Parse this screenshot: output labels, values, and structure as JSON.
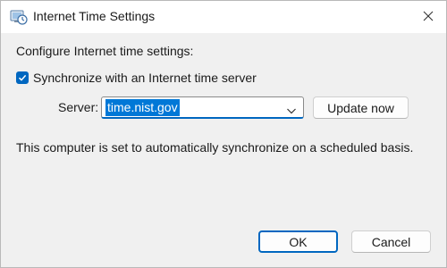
{
  "window": {
    "title": "Internet Time Settings",
    "icon": "internet-time-icon",
    "close_icon": "close-icon"
  },
  "main": {
    "heading": "Configure Internet time settings:",
    "sync_checkbox": {
      "label": "Synchronize with an Internet time server",
      "checked": true
    },
    "server": {
      "label": "Server:",
      "value": "time.nist.gov"
    },
    "update_button": "Update now",
    "status": "This computer is set to automatically synchronize on a scheduled basis."
  },
  "footer": {
    "ok_label": "OK",
    "cancel_label": "Cancel"
  },
  "colors": {
    "accent": "#0067c0",
    "selection": "#0078d7",
    "dialog_bg": "#f0f0f0"
  }
}
